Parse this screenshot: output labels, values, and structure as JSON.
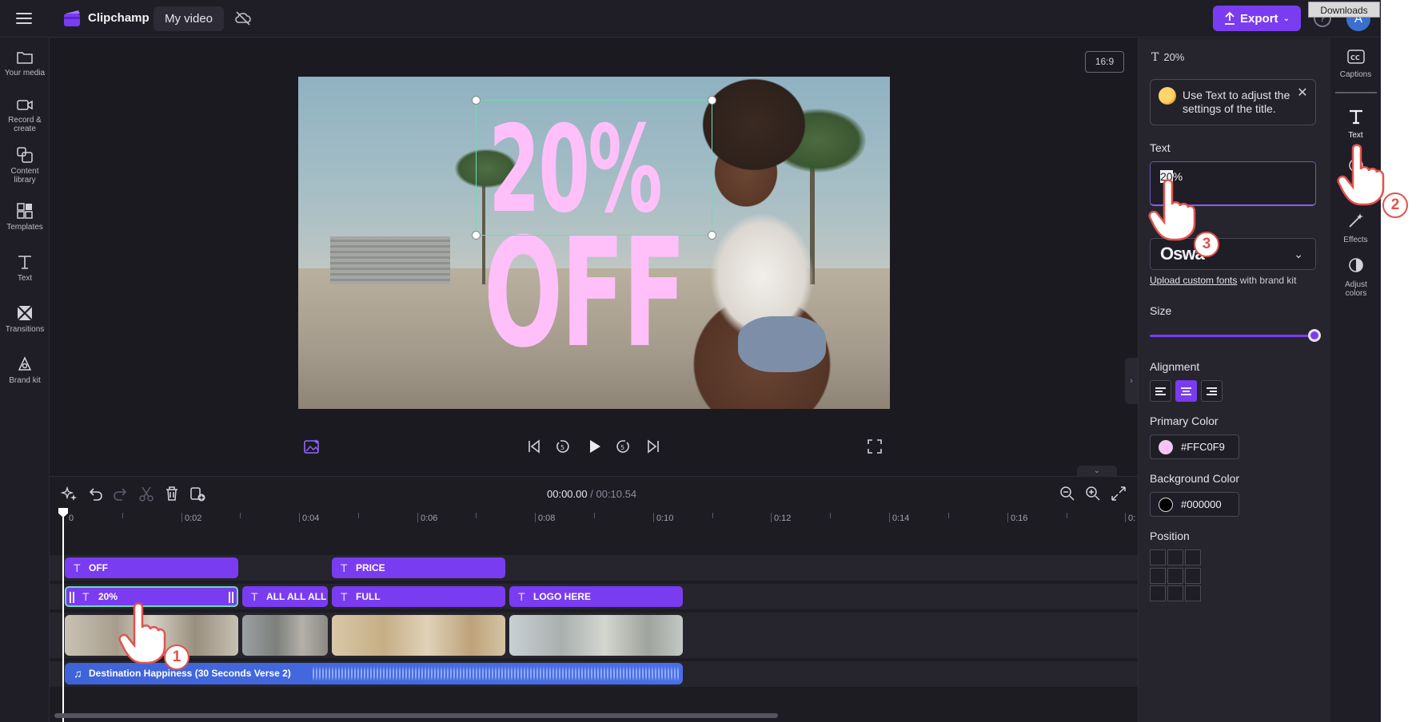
{
  "app": {
    "brand": "Clipchamp",
    "project_name": "My video",
    "export_label": "Export",
    "avatar_initial": "A",
    "help_glyph": "?",
    "downloads_tooltip": "Downloads",
    "accent_color": "#7a3cf0"
  },
  "left_sidebar": {
    "items": [
      {
        "label": "Your media",
        "icon": "folder-icon"
      },
      {
        "label": "Record & create",
        "icon": "camera-icon"
      },
      {
        "label": "Content library",
        "icon": "library-icon"
      },
      {
        "label": "Templates",
        "icon": "templates-icon"
      },
      {
        "label": "Text",
        "icon": "text-icon"
      },
      {
        "label": "Transitions",
        "icon": "transitions-icon"
      },
      {
        "label": "Brand kit",
        "icon": "brand-kit-icon"
      }
    ]
  },
  "preview": {
    "aspect_ratio": "16:9",
    "overlay_line1": "20%",
    "overlay_line2": "OFF",
    "overlay_color": "#FFC0F9"
  },
  "timeline": {
    "current_time": "00:00.00",
    "separator": "/",
    "total_time": "00:10.54",
    "ticks": [
      "0",
      "0:02",
      "0:04",
      "0:06",
      "0:08",
      "0:10",
      "0:12",
      "0:14",
      "0:16",
      "0:"
    ],
    "text_track_1": [
      {
        "label": "OFF"
      },
      {
        "label": "PRICE"
      }
    ],
    "text_track_2": [
      {
        "label": "20%"
      },
      {
        "label": "ALL ALL ALL A"
      },
      {
        "label": "FULL"
      },
      {
        "label": "LOGO HERE"
      }
    ],
    "audio_clip": "Destination Happiness (30 Seconds Verse 2)"
  },
  "panel": {
    "header": "20%",
    "tip": "Use Text to adjust the settings of the title.",
    "text_label": "Text",
    "text_value_highlight": "20",
    "text_value_rest": "%",
    "font_value": "Oswa",
    "upload_link": "Upload custom fonts",
    "upload_suffix": " with brand kit",
    "size_label": "Size",
    "size_fraction": 1.0,
    "alignment_label": "Alignment",
    "alignment_selected": "center",
    "primary_color_label": "Primary Color",
    "primary_color": "#FFC0F9",
    "background_color_label": "Background Color",
    "background_color": "#000000",
    "position_label": "Position"
  },
  "right_tabs": {
    "items": [
      {
        "label": "Captions",
        "icon": "captions-icon"
      },
      {
        "label": "Text",
        "icon": "text-icon"
      },
      {
        "label": "Effects",
        "icon": "effects-icon"
      },
      {
        "label": "Adjust colors",
        "icon": "adjust-colors-icon"
      }
    ]
  },
  "tutorial_steps": [
    "1",
    "2",
    "3"
  ]
}
